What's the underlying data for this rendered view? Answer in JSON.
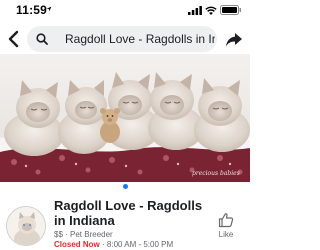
{
  "status_bar": {
    "time": "11:59",
    "icons": [
      "location-arrow-icon",
      "signal-icon",
      "wifi-icon",
      "battery-icon"
    ]
  },
  "nav": {
    "search_text": "Ragdoll Love - Ragdolls in Indi...",
    "icons": [
      "back-chevron-icon",
      "search-icon",
      "share-icon"
    ]
  },
  "cover": {
    "description_icon": "photo",
    "watermark": "precious babies"
  },
  "page": {
    "title": "Ragdoll Love - Ragdolls in Indiana",
    "price": "$$",
    "separator": " · ",
    "category": "Pet Breeder",
    "status": "Closed Now",
    "hours": " · 8:00 AM - 5:00 PM"
  },
  "actions": {
    "like_label": "Like"
  },
  "colors": {
    "accent": "#1877f2",
    "closed": "#e4282c",
    "search_bg": "#eeeff1",
    "muted_text": "#65676b"
  }
}
